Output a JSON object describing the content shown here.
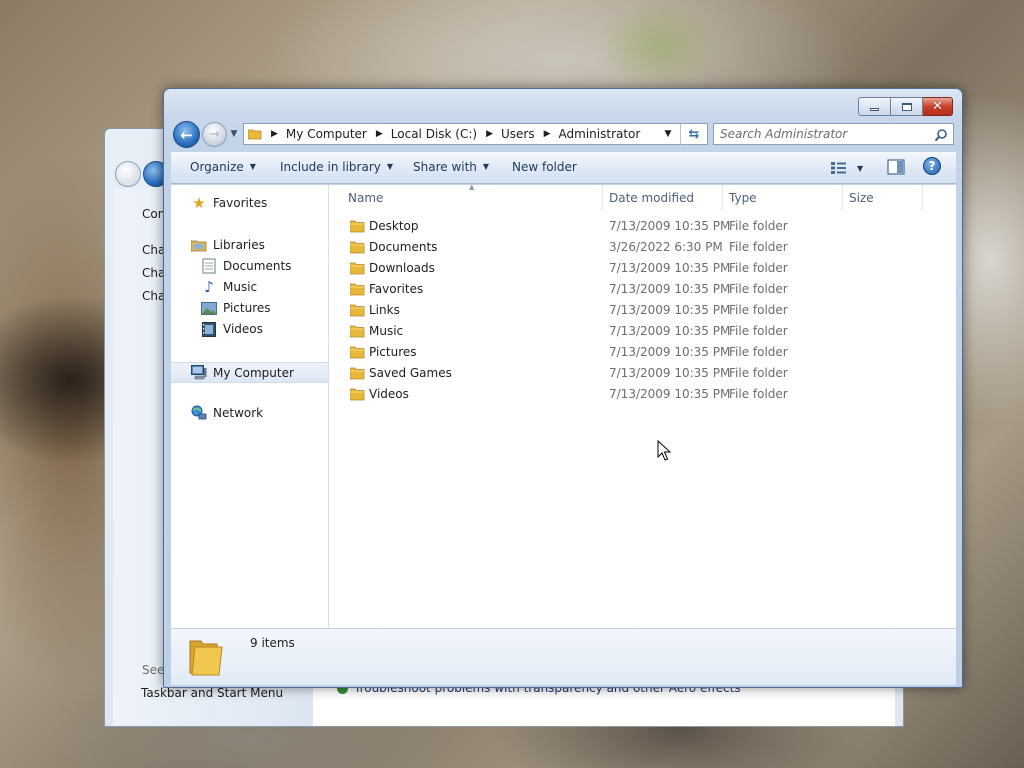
{
  "background_window": {
    "links": [
      "Con",
      "Cha",
      "Cha",
      "Cha"
    ],
    "see_also": "See",
    "footer_link": "Taskbar and Start Menu",
    "troubleshoot": "Troubleshoot problems with transparency and other Aero effects"
  },
  "window": {
    "controls": {
      "minimize": "minimize-icon",
      "maximize": "maximize-icon",
      "close": "close-icon"
    }
  },
  "address": {
    "crumbs": [
      "My Computer",
      "Local Disk (C:)",
      "Users",
      "Administrator"
    ]
  },
  "search": {
    "placeholder": "Search Administrator"
  },
  "toolbar": {
    "organize": "Organize",
    "include_library": "Include in library",
    "share_with": "Share with",
    "new_folder": "New folder"
  },
  "nav": {
    "favorites": "Favorites",
    "libraries": "Libraries",
    "library_items": [
      "Documents",
      "Music",
      "Pictures",
      "Videos"
    ],
    "computer": "My Computer",
    "network": "Network"
  },
  "columns": {
    "name": "Name",
    "date": "Date modified",
    "type": "Type",
    "size": "Size"
  },
  "files": [
    {
      "name": "Desktop",
      "date": "7/13/2009 10:35 PM",
      "type": "File folder"
    },
    {
      "name": "Documents",
      "date": "3/26/2022 6:30 PM",
      "type": "File folder"
    },
    {
      "name": "Downloads",
      "date": "7/13/2009 10:35 PM",
      "type": "File folder"
    },
    {
      "name": "Favorites",
      "date": "7/13/2009 10:35 PM",
      "type": "File folder"
    },
    {
      "name": "Links",
      "date": "7/13/2009 10:35 PM",
      "type": "File folder"
    },
    {
      "name": "Music",
      "date": "7/13/2009 10:35 PM",
      "type": "File folder"
    },
    {
      "name": "Pictures",
      "date": "7/13/2009 10:35 PM",
      "type": "File folder"
    },
    {
      "name": "Saved Games",
      "date": "7/13/2009 10:35 PM",
      "type": "File folder"
    },
    {
      "name": "Videos",
      "date": "7/13/2009 10:35 PM",
      "type": "File folder"
    }
  ],
  "status": {
    "count": "9 items"
  },
  "colors": {
    "folder": "#e8b83a",
    "accent": "#2a6fc0",
    "close": "#c8412a"
  }
}
